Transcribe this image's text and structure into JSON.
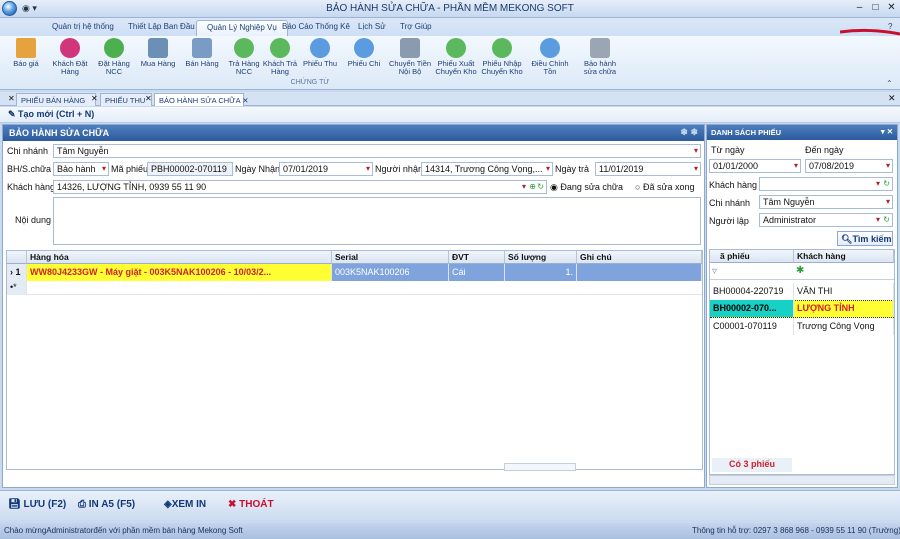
{
  "window": {
    "title": "BẢO HÀNH SỬA CHỮA - PHẦN MỀM MEKONG SOFT"
  },
  "menu": [
    "Quản trị hệ thống",
    "Thiết Lập Ban Đầu",
    "Quản Lý Nghiệp Vụ",
    "Báo Cáo Thống Kê",
    "Lịch Sử",
    "Trợ Giúp"
  ],
  "ribbon": {
    "buttons": [
      "Báo giá",
      "Khách Đặt Hàng",
      "Đặt Hàng NCC",
      "Mua Hàng",
      "Bán Hàng",
      "Trả Hàng NCC",
      "Khách Trả Hàng",
      "Phiếu Thu",
      "Phiếu Chi",
      "Chuyển Tiền Nội Bộ",
      "Phiếu Xuất Chuyển Kho",
      "Phiếu Nhập Chuyển Kho",
      "Điều Chỉnh Tồn",
      "Bảo hành sửa chữa"
    ],
    "group": "CHỨNG TỪ"
  },
  "doc_tabs": [
    "PHIẾU BÁN HÀNG",
    "PHIẾU THU",
    "BẢO HÀNH SỬA CHỮA"
  ],
  "toolbar": {
    "new_label": "Tạo mới (Ctrl + N)"
  },
  "form": {
    "header": "BẢO HÀNH SỬA CHỮA",
    "branch_label": "Chi nhánh",
    "branch": "Tâm Nguyễn",
    "type_label": "BH/S.chữa",
    "type": "Bảo hành",
    "code_label": "Mã phiếu",
    "code": "PBH00002-070119",
    "recv_date_label": "Ngày Nhận",
    "recv_date": "07/01/2019",
    "receiver_label": "Người nhận",
    "receiver": "14314, Trương Công Vọng,...",
    "return_date_label": "Ngày trả",
    "return_date": "11/01/2019",
    "customer_label": "Khách hàng",
    "customer": "14326, LƯỢNG TỈNH, 0939 55 11 90",
    "status_repairing": "Đang sửa chữa",
    "status_done": "Đã sửa xong",
    "content_label": "Nội dung"
  },
  "grid": {
    "headers": [
      "Hàng hóa",
      "Serial",
      "ĐVT",
      "Số lượng",
      "Ghi chú"
    ],
    "rows": [
      {
        "num": "1",
        "item": "WW80J4233GW - Máy giặt - 003K5NAK100206 - 10/03/2...",
        "serial": "003K5NAK100206",
        "unit": "Cái",
        "qty": "1."
      }
    ]
  },
  "actions": {
    "save": "LƯU (F2)",
    "print_a5": "IN A5 (F5)",
    "view_print": "XEM IN",
    "exit": "THOÁT"
  },
  "status": {
    "left": "Chào mừngAdministratorđến với phần mềm bán hàng Mekong Soft",
    "right": "Thông tin hỗ trợ: 0297 3 868 968 - 0939 55 11 90 (Trường)"
  },
  "list_panel": {
    "header": "DANH SÁCH PHIẾU",
    "from_label": "Từ ngày",
    "from": "01/01/2000",
    "to_label": "Đến ngày",
    "to": "07/08/2019",
    "customer_label": "Khách hàng",
    "customer": "",
    "branch_label": "Chi nhánh",
    "branch": "Tâm Nguyễn",
    "creator_label": "Người lập",
    "creator": "Administrator",
    "search": "Tìm kiếm",
    "headers": [
      "ã phiếu",
      "Khách hàng"
    ],
    "rows": [
      {
        "code": "BH00004-220719",
        "customer": "VĂN THI"
      },
      {
        "code": "BH00002-070...",
        "customer": "LƯỢNG TỈNH"
      },
      {
        "code": "C00001-070119",
        "customer": "Trương Công Vọng"
      }
    ],
    "count": "Có 3 phiếu"
  },
  "colors": {
    "accent": "#2b5a9c",
    "selected_row": "#7fa3dc",
    "highlight": "#ffff33",
    "error": "#b0202a"
  }
}
